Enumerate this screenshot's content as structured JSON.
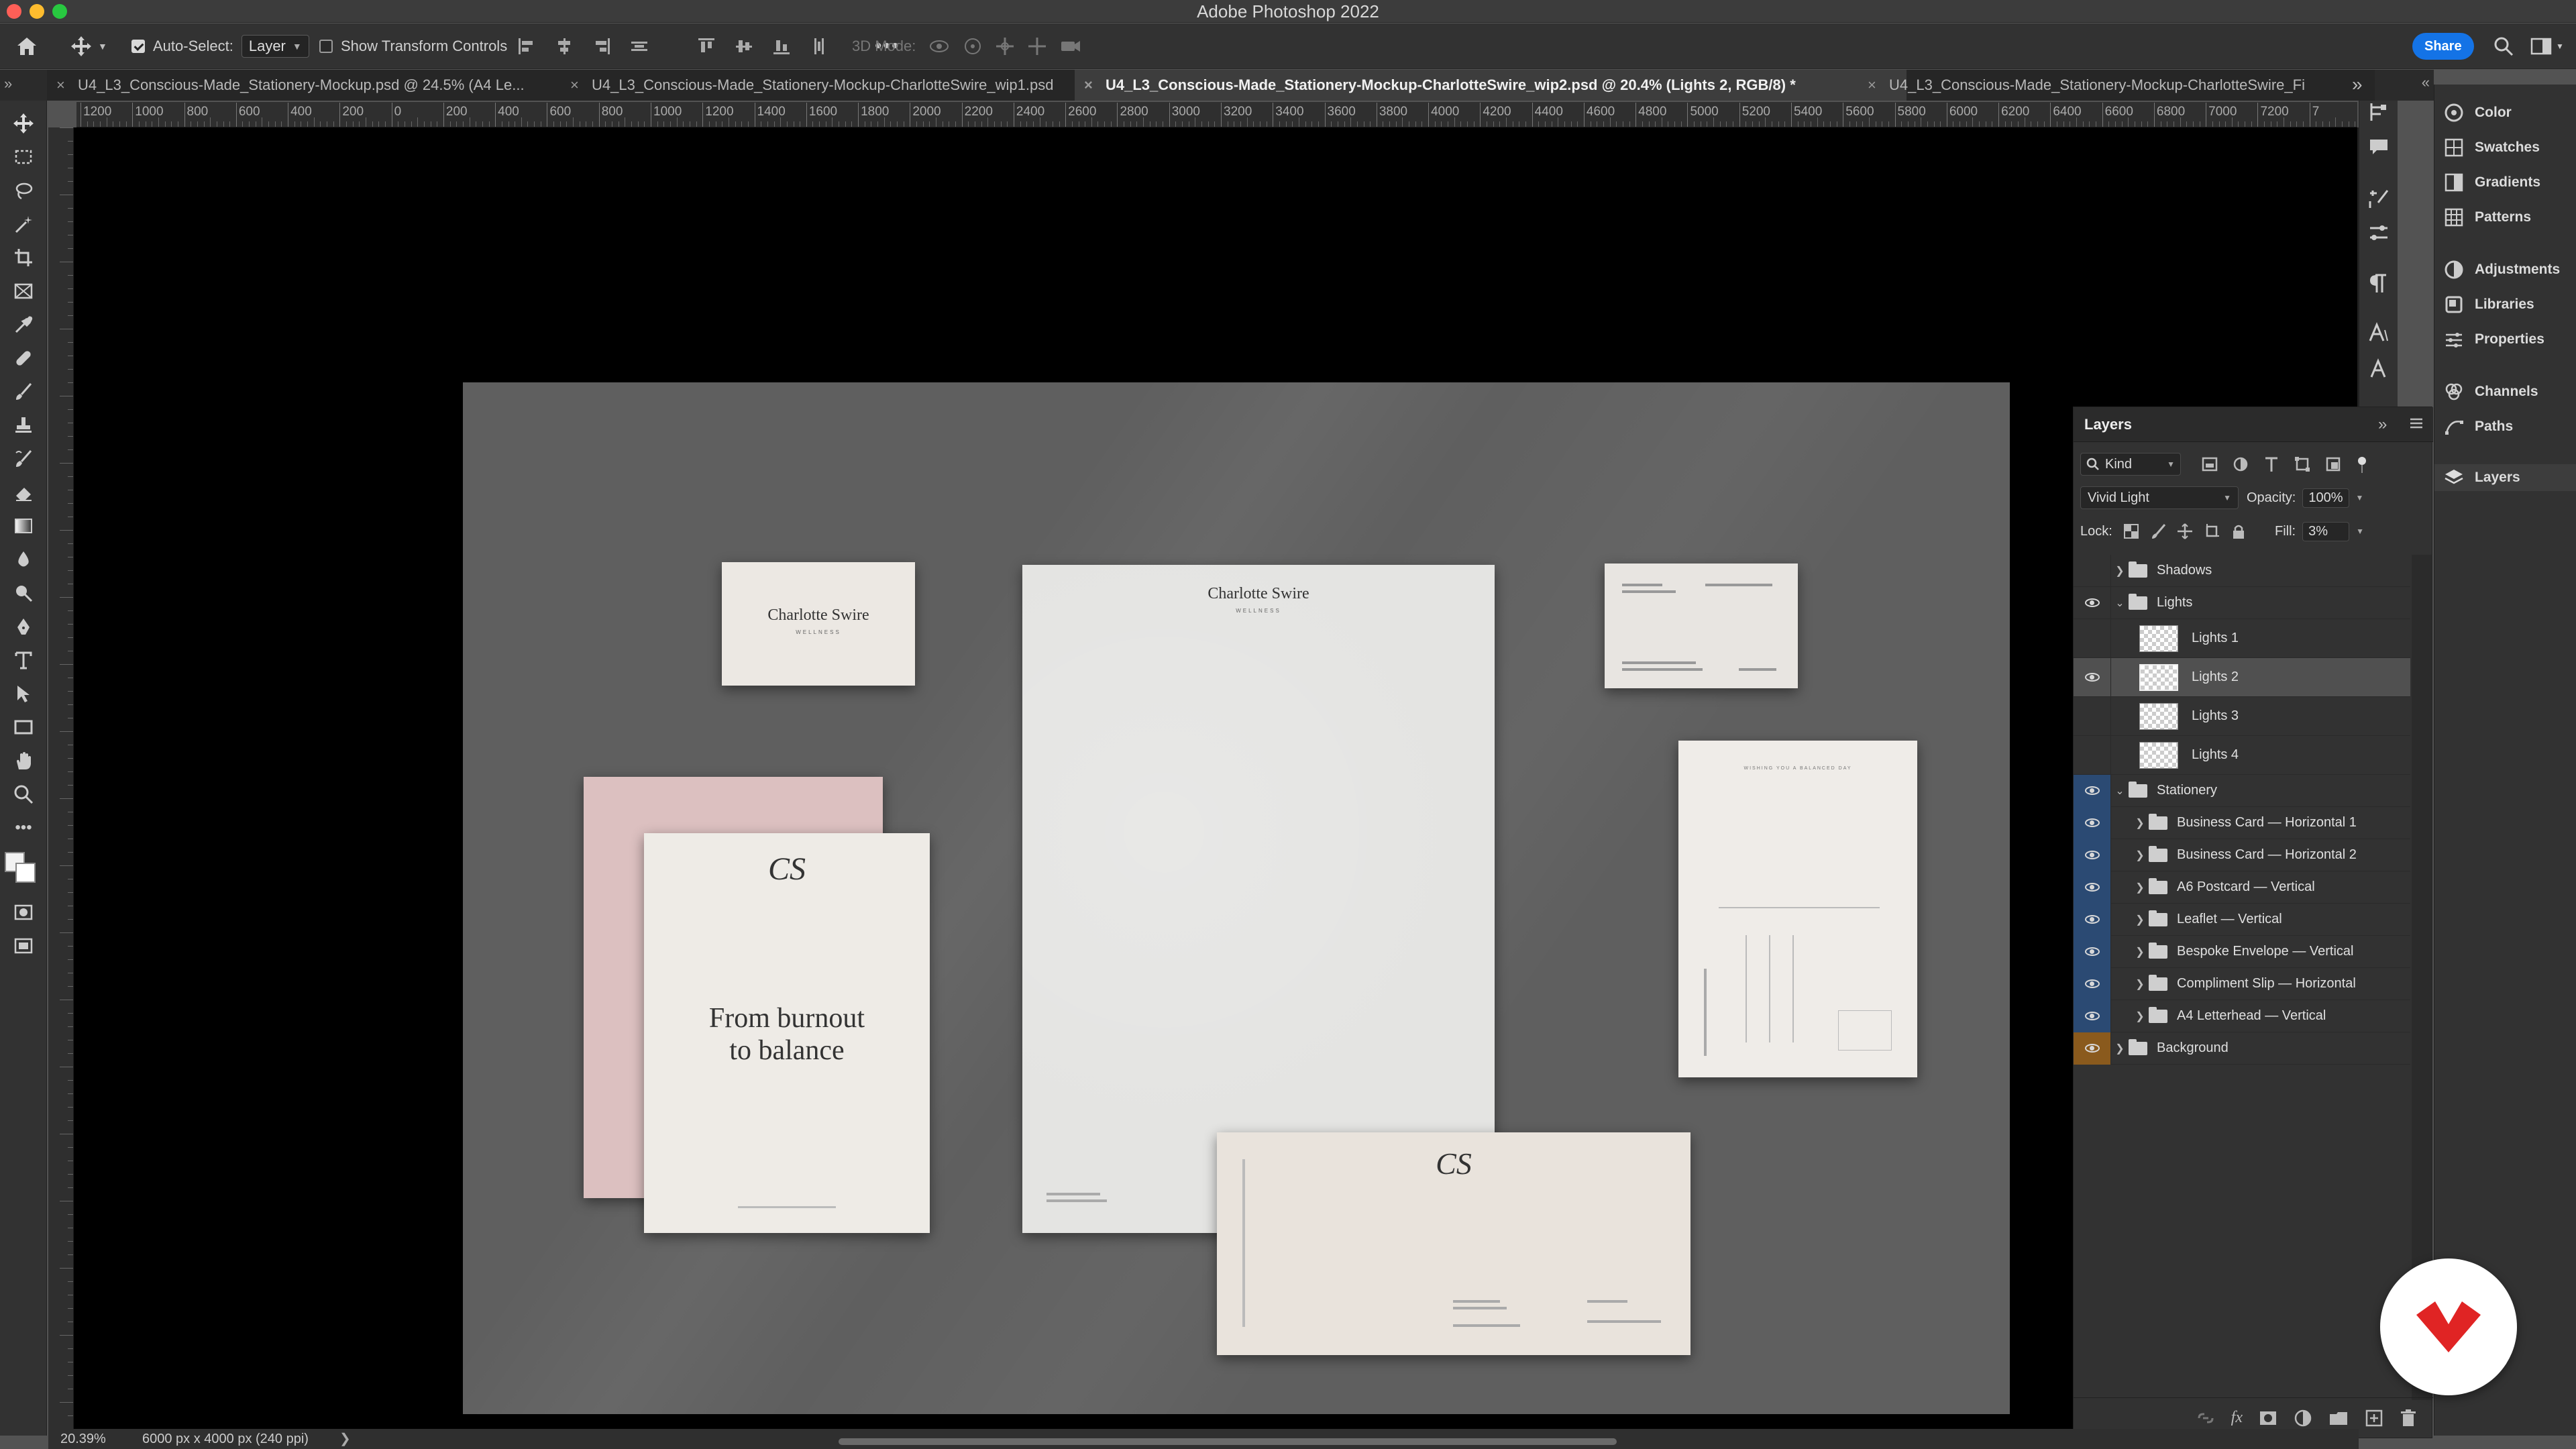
{
  "window": {
    "title": "Adobe Photoshop 2022"
  },
  "options_bar": {
    "auto_select_label": "Auto-Select:",
    "auto_select_value": "Layer",
    "show_transform_label": "Show Transform Controls",
    "mode_3d_label": "3D Mode:",
    "share_label": "Share"
  },
  "tabs": [
    {
      "label": "U4_L3_Conscious-Made_Stationery-Mockup.psd @ 24.5% (A4 Le..."
    },
    {
      "label": "U4_L3_Conscious-Made_Stationery-Mockup-CharlotteSwire_wip1.psd"
    },
    {
      "label": "U4_L3_Conscious-Made_Stationery-Mockup-CharlotteSwire_wip2.psd @ 20.4% (Lights 2, RGB/8) *"
    },
    {
      "label": "U4_L3_Conscious-Made_Stationery-Mockup-CharlotteSwire_Fi"
    }
  ],
  "ruler_labels": [
    "1200",
    "1000",
    "800",
    "600",
    "400",
    "200",
    "0",
    "200",
    "400",
    "600",
    "800",
    "1000",
    "1200",
    "1400",
    "1600",
    "1800",
    "2000",
    "2200",
    "2400",
    "2600",
    "2800",
    "3000",
    "3200",
    "3400",
    "3600",
    "3800",
    "4000",
    "4200",
    "4400",
    "4600",
    "4800",
    "5000",
    "5200",
    "5400",
    "5600",
    "5800",
    "6000",
    "6200",
    "6400",
    "6600",
    "6800",
    "7000",
    "7200",
    "7"
  ],
  "right_dock": [
    {
      "label": "Color",
      "icon": "color-wheel-icon"
    },
    {
      "label": "Swatches",
      "icon": "swatches-grid-icon"
    },
    {
      "label": "Gradients",
      "icon": "gradient-icon"
    },
    {
      "label": "Patterns",
      "icon": "patterns-grid-icon"
    },
    {
      "label": "Adjustments",
      "icon": "adjustments-icon"
    },
    {
      "label": "Libraries",
      "icon": "libraries-icon"
    },
    {
      "label": "Properties",
      "icon": "sliders-icon"
    },
    {
      "label": "Channels",
      "icon": "channels-icon"
    },
    {
      "label": "Paths",
      "icon": "paths-icon"
    },
    {
      "label": "Layers",
      "icon": "layers-stack-icon"
    }
  ],
  "layers_panel": {
    "title": "Layers",
    "filter_kind": "Kind",
    "blend_mode": "Vivid Light",
    "opacity_label": "Opacity:",
    "opacity_value": "100%",
    "lock_label": "Lock:",
    "fill_label": "Fill:",
    "fill_value": "3%",
    "layers": [
      {
        "name": "Shadows",
        "kind": "group",
        "visible": false,
        "expanded": false
      },
      {
        "name": "Lights",
        "kind": "group",
        "visible": true,
        "expanded": true
      },
      {
        "name": "Lights 1",
        "kind": "layer",
        "visible": false
      },
      {
        "name": "Lights 2",
        "kind": "layer",
        "visible": true,
        "selected": true
      },
      {
        "name": "Lights 3",
        "kind": "layer",
        "visible": false
      },
      {
        "name": "Lights 4",
        "kind": "layer",
        "visible": false
      },
      {
        "name": "Stationery",
        "kind": "group",
        "visible": true,
        "expanded": true
      },
      {
        "name": "Business Card — Horizontal 1",
        "kind": "subgroup",
        "visible": true
      },
      {
        "name": "Business Card — Horizontal 2",
        "kind": "subgroup",
        "visible": true
      },
      {
        "name": "A6 Postcard — Vertical",
        "kind": "subgroup",
        "visible": true
      },
      {
        "name": "Leaflet — Vertical",
        "kind": "subgroup",
        "visible": true
      },
      {
        "name": "Bespoke Envelope — Vertical",
        "kind": "subgroup",
        "visible": true
      },
      {
        "name": "Compliment Slip — Horizontal",
        "kind": "subgroup",
        "visible": true
      },
      {
        "name": "A4 Letterhead — Vertical",
        "kind": "subgroup",
        "visible": true
      },
      {
        "name": "Background",
        "kind": "group",
        "visible": true
      }
    ]
  },
  "canvas": {
    "brand_name": "Charlotte Swire",
    "brand_sub": "WELLNESS",
    "monogram": "CS",
    "leaflet_headline_1": "From burnout",
    "leaflet_headline_2": "to balance",
    "postcard_heading": "WISHING YOU A BALANCED DAY"
  },
  "status": {
    "zoom": "20.39%",
    "doc_size": "6000 px x 4000 px (240 ppi)"
  }
}
